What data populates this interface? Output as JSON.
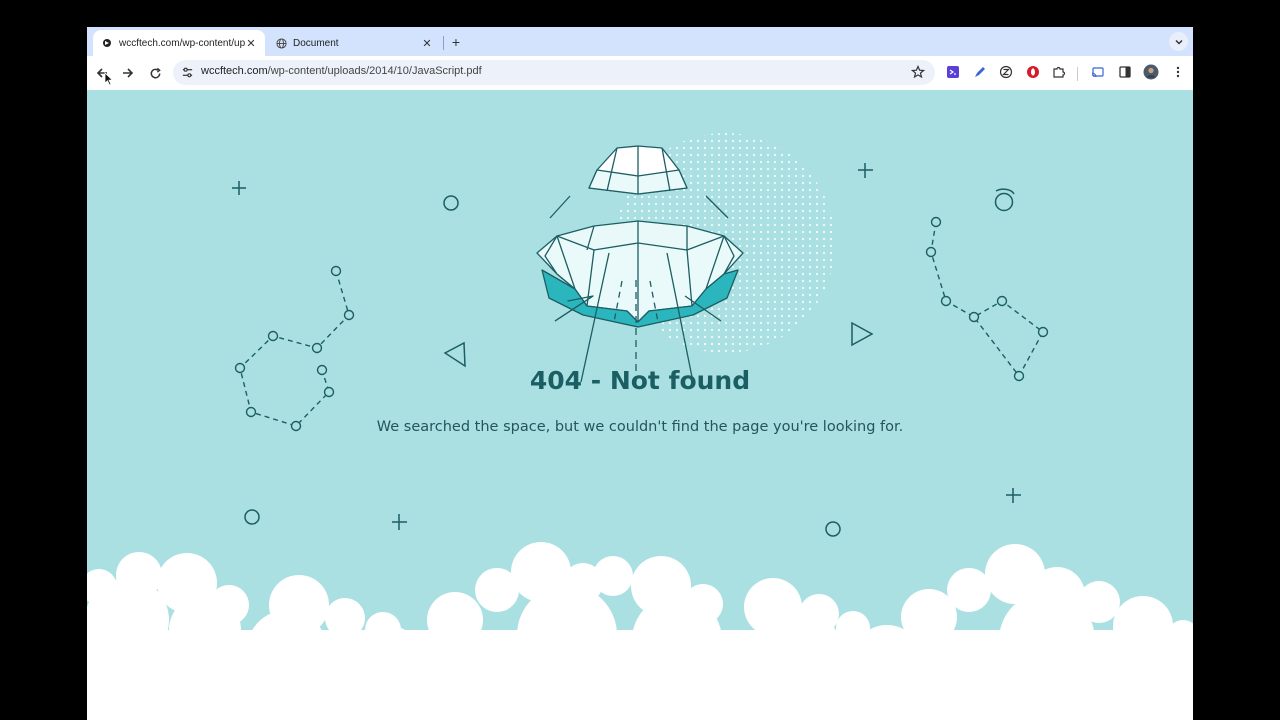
{
  "browser": {
    "tabs": [
      {
        "title": "wccftech.com/wp-content/up",
        "active": true
      },
      {
        "title": "Document",
        "active": false
      }
    ],
    "new_tab_label": "+",
    "close_glyph": "✕",
    "address": {
      "host": "wccftech.com",
      "path": "/wp-content/uploads/2014/10/JavaScript.pdf"
    },
    "icons": [
      "back-icon",
      "forward-icon",
      "reload-icon",
      "site-settings-icon",
      "bookmark-star-icon",
      "extension-icon",
      "puzzle-icon",
      "cast-icon",
      "sidebar-icon",
      "profile-avatar",
      "more-menu-icon"
    ]
  },
  "page": {
    "title": "404 - Not found",
    "message": "We searched the space, but we couldn't find the page you're looking for."
  },
  "colors": {
    "background": "#abe0e3",
    "line": "#1b5e63",
    "accent": "#2bb6bd",
    "tabbar": "#d3e3fd"
  }
}
